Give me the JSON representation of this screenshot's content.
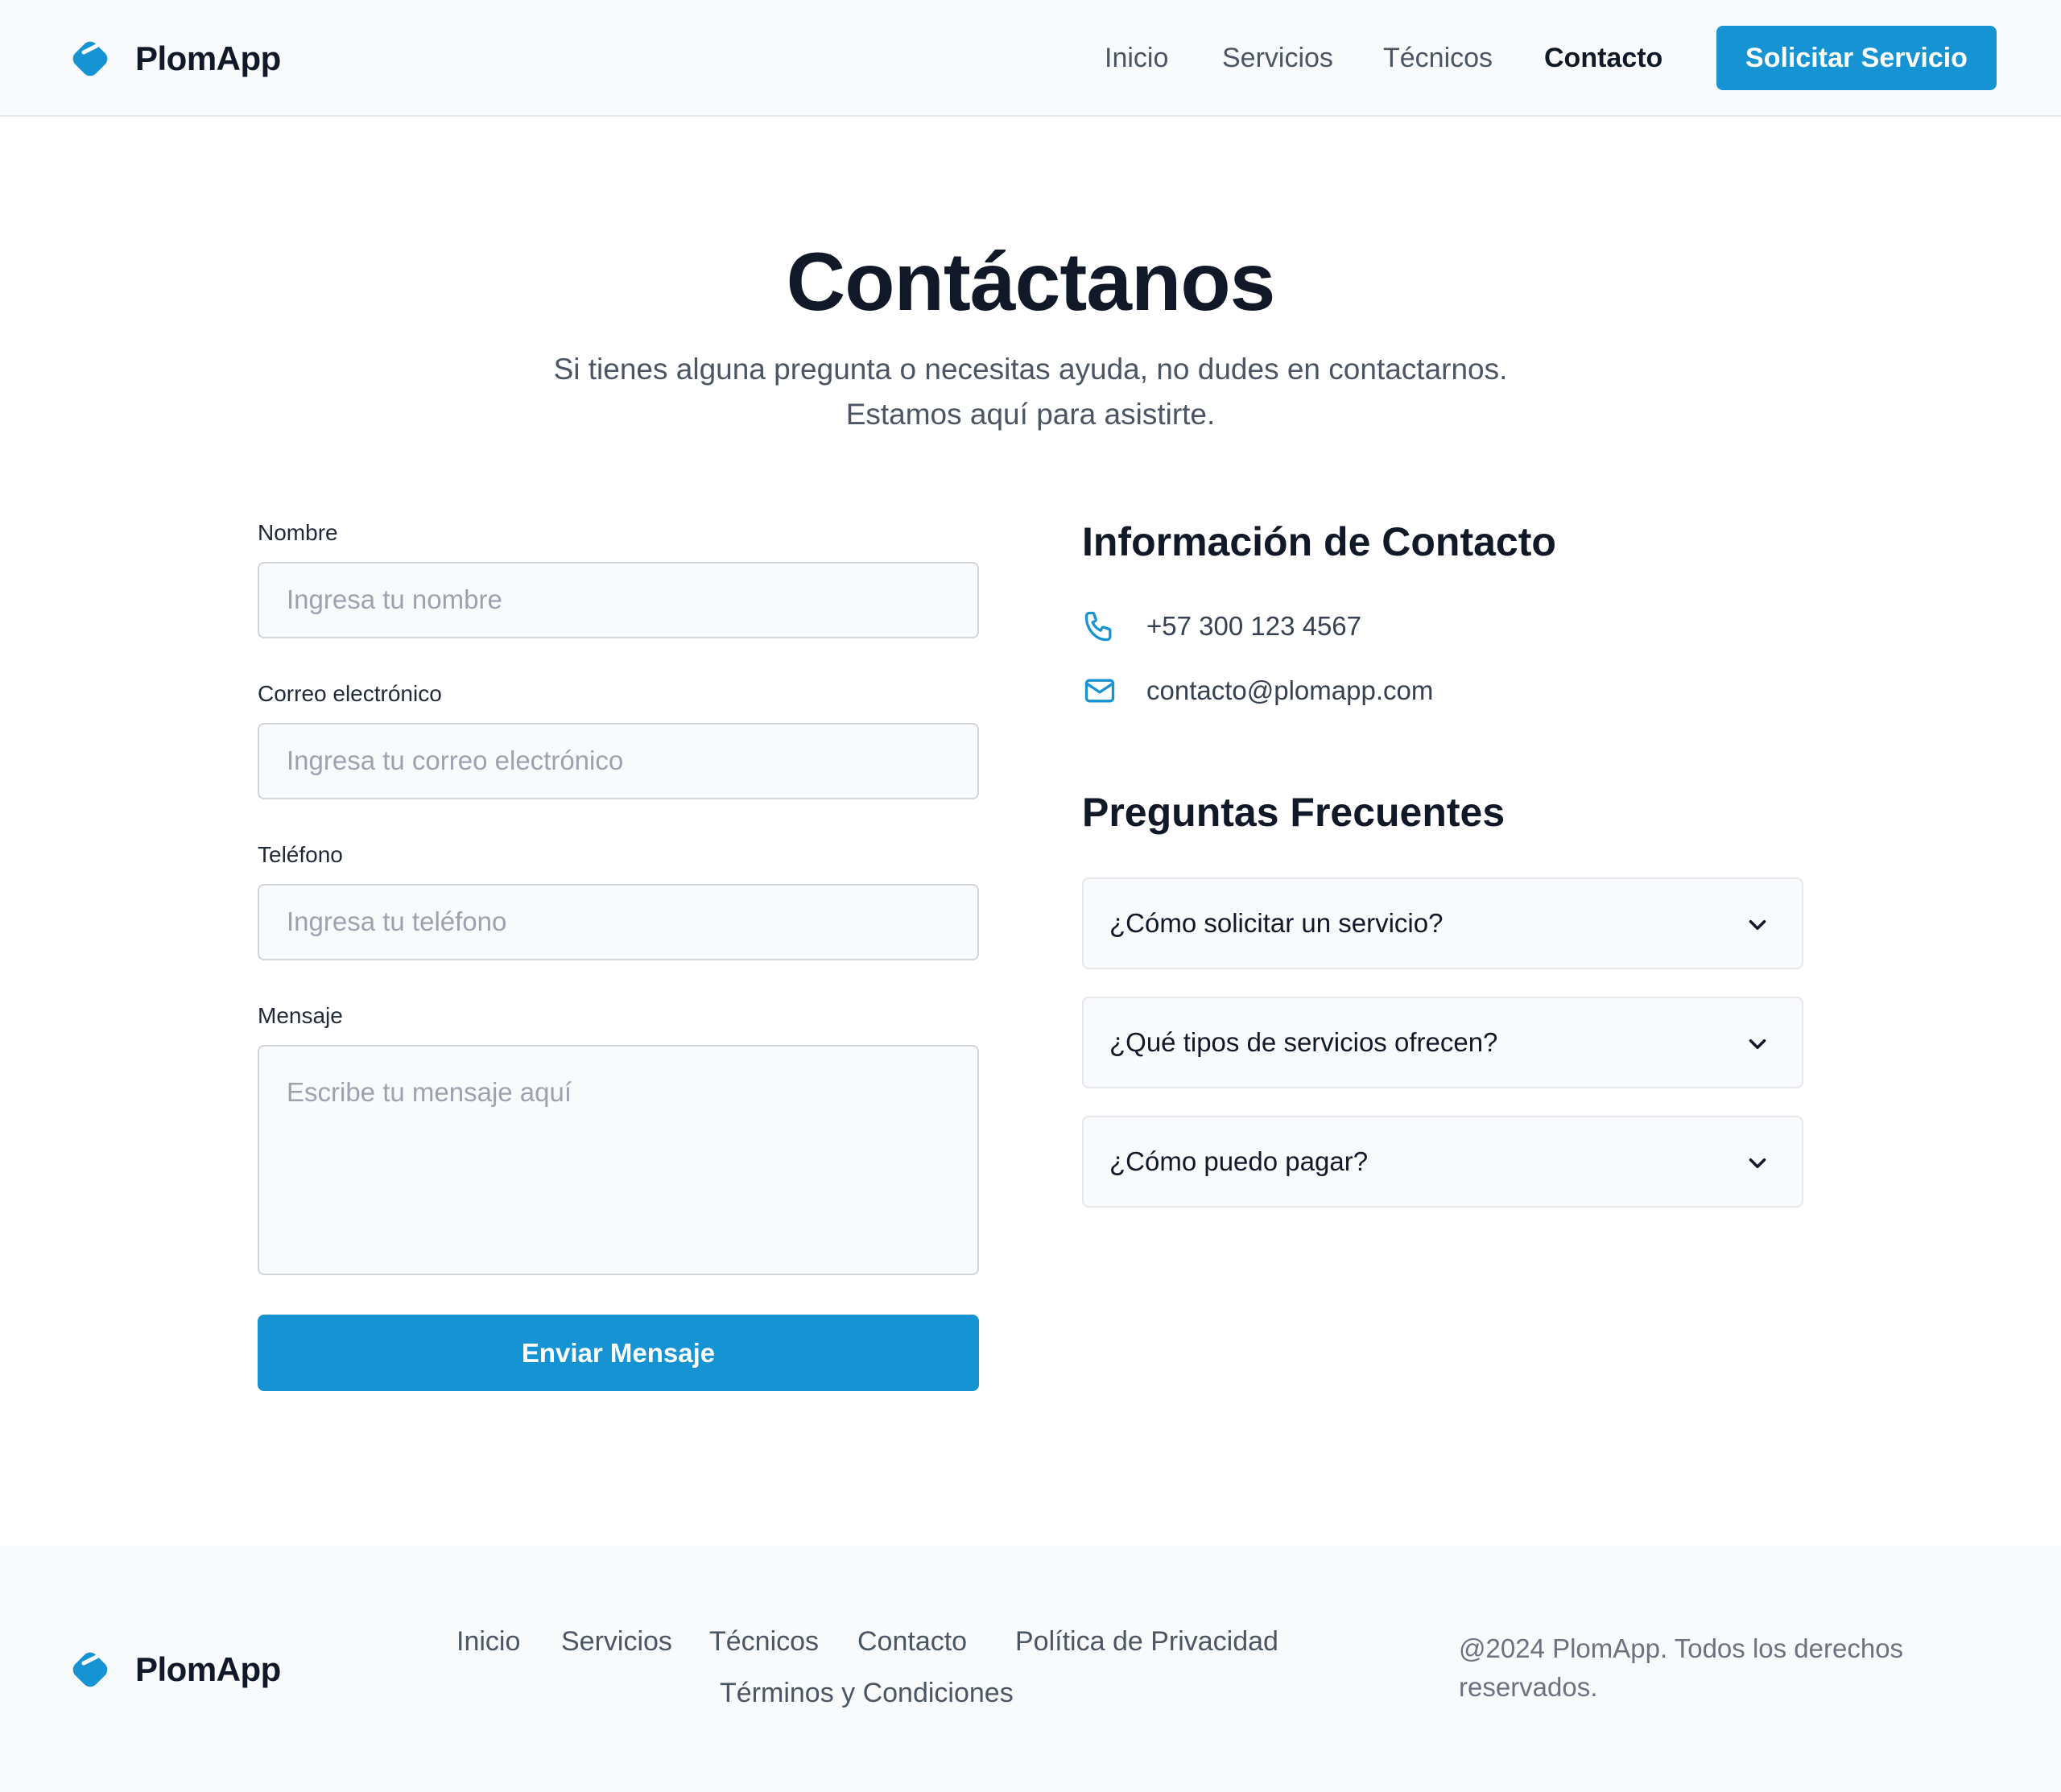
{
  "brand": {
    "name": "PlomApp",
    "accent": "#1593d3"
  },
  "header": {
    "nav": [
      "Inicio",
      "Servicios",
      "Técnicos",
      "Contacto"
    ],
    "active": "Contacto",
    "cta": "Solicitar Servicio"
  },
  "hero": {
    "title": "Contáctanos",
    "subtitle_1": "Si tienes alguna pregunta o necesitas ayuda, no dudes en contactarnos.",
    "subtitle_2": "Estamos aquí para asistirte."
  },
  "form": {
    "name_label": "Nombre",
    "name_placeholder": "Ingresa tu nombre",
    "email_label": "Correo electrónico",
    "email_placeholder": "Ingresa tu correo electrónico",
    "phone_label": "Teléfono",
    "phone_placeholder": "Ingresa tu teléfono",
    "message_label": "Mensaje",
    "message_placeholder": "Escribe tu mensaje aquí",
    "submit": "Enviar Mensaje"
  },
  "contact": {
    "title": "Información de Contacto",
    "phone": "+57 300 123 4567",
    "email": "contacto@plomapp.com",
    "icons": [
      "phone-icon",
      "mail-icon"
    ]
  },
  "faq": {
    "title": "Preguntas Frecuentes",
    "items": [
      "¿Cómo solicitar un servicio?",
      "¿Qué tipos de servicios ofrecen?",
      "¿Cómo puedo pagar?"
    ]
  },
  "footer": {
    "links": [
      "Inicio",
      "Servicios",
      "Técnicos",
      "Contacto",
      "Política de Privacidad",
      "Términos y Condiciones"
    ],
    "copyright": "@2024 PlomApp. Todos los derechos reservados."
  }
}
